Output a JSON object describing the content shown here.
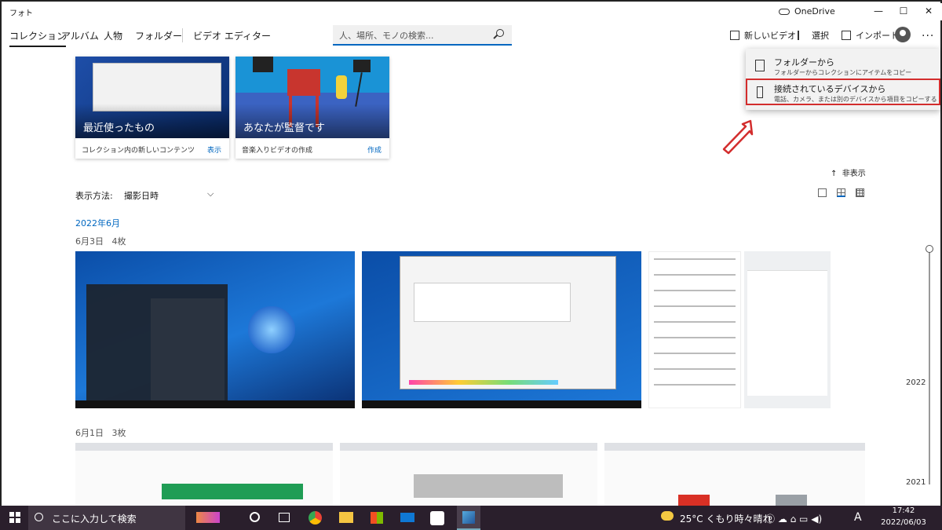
{
  "window": {
    "title": "フォト",
    "onedrive": "OneDrive",
    "minimize": "—",
    "maximize": "☐",
    "close": "✕"
  },
  "nav": {
    "tabs": [
      "コレクション",
      "アルバム",
      "人物",
      "フォルダー",
      "ビデオ エディター"
    ],
    "search_placeholder": "人、場所、モノの検索..."
  },
  "toolbar": {
    "new_video": "新しいビデオ",
    "select": "選択",
    "import": "インポート",
    "more": "..."
  },
  "cards": [
    {
      "title": "最近使ったもの",
      "desc": "コレクション内の新しいコンテンツ",
      "action": "表示"
    },
    {
      "title": "あなたが監督です",
      "desc": "音楽入りビデオの作成",
      "action": "作成"
    }
  ],
  "import_menu": [
    {
      "title": "フォルダーから",
      "sub": "フォルダーからコレクションにアイテムをコピー"
    },
    {
      "title": "接続されているデバイスから",
      "sub": "電話、カメラ、または別のデバイスから項目をコピーする"
    }
  ],
  "view": {
    "hide_label": "非表示",
    "hide_arrow": "↑",
    "view_by_label": "表示方法:",
    "view_by_value": "撮影日時",
    "chevron": "⌵"
  },
  "gallery": {
    "month": "2022年6月",
    "groups": [
      {
        "date": "6月3日",
        "count": "4枚"
      },
      {
        "date": "6月1日",
        "count": "3枚"
      }
    ]
  },
  "timeline": {
    "years": [
      "2022",
      "2021"
    ]
  },
  "taskbar": {
    "search": "ここに入力して検索",
    "weather": "25°C くもり時々晴れ",
    "ime": "A",
    "time": "17:42",
    "date": "2022/06/03"
  },
  "colors": {
    "accent": "#0067c0",
    "highlight": "#d32d2d",
    "taskbar": "#2a1f2c"
  }
}
